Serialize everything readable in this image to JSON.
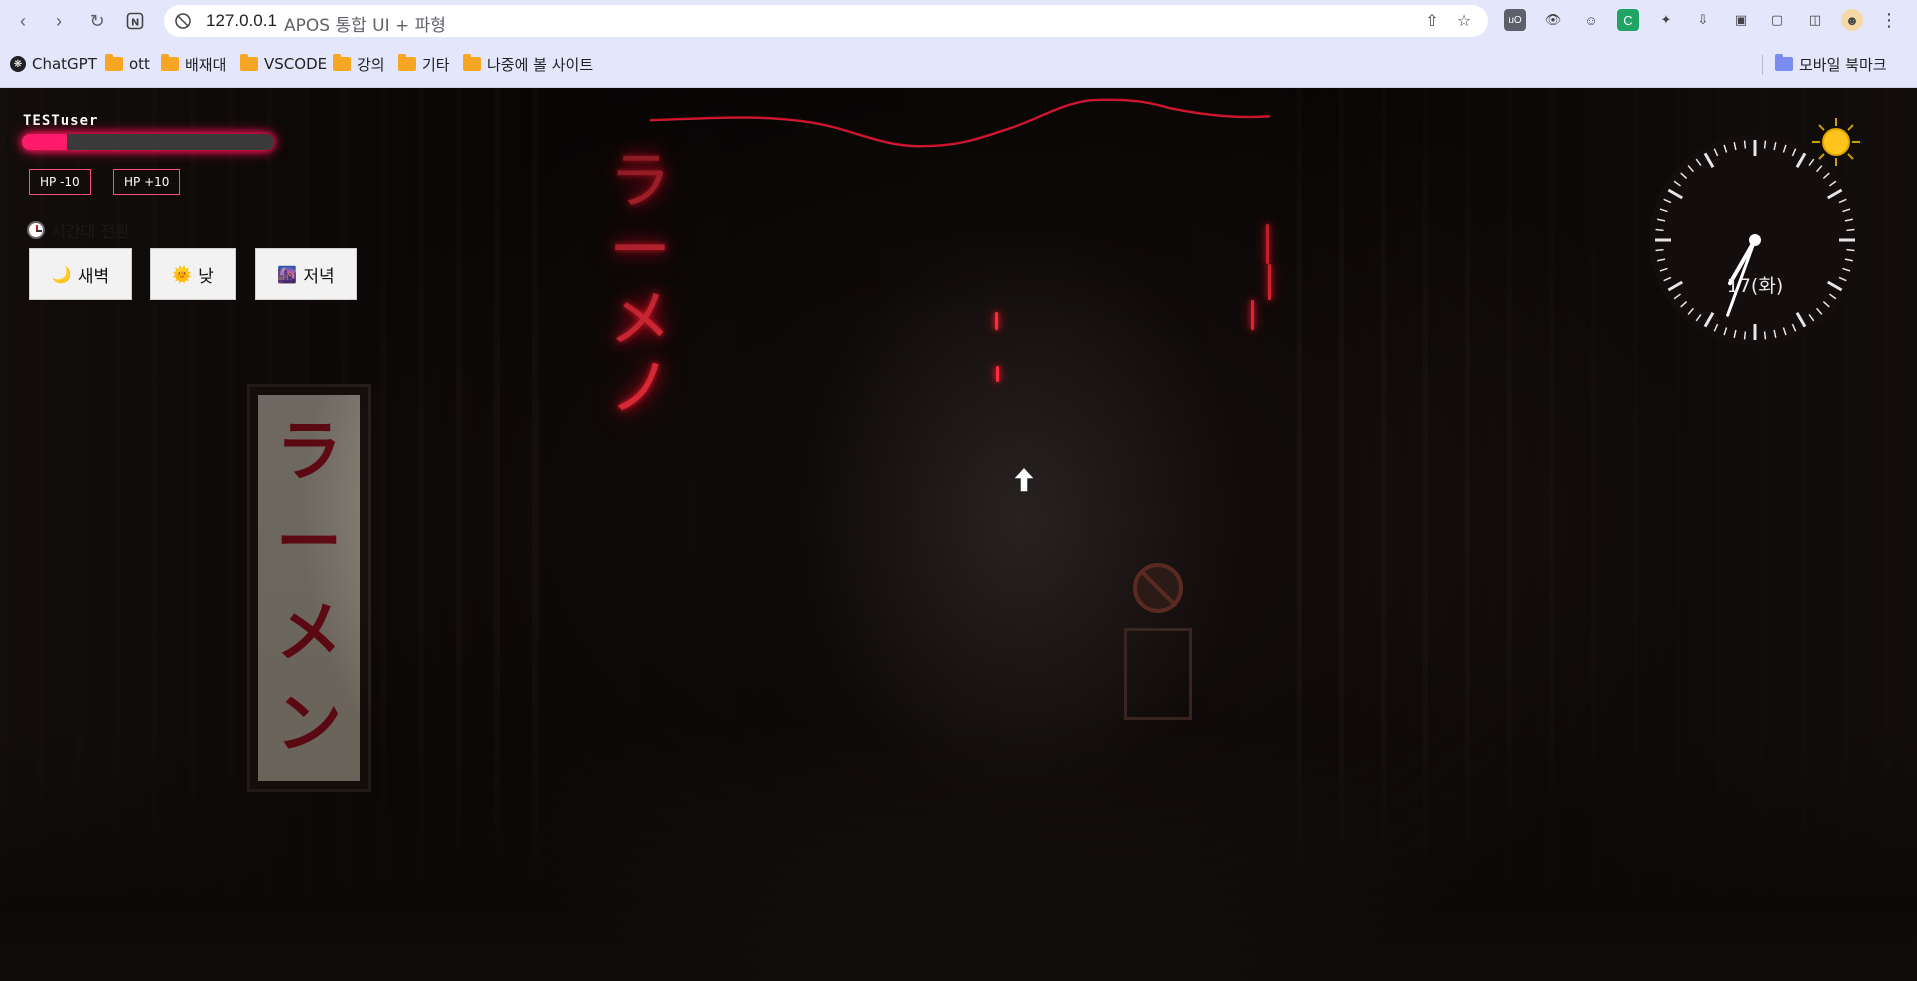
{
  "browser": {
    "url_host": "127.0.0.1",
    "page_title": "APOS 통합 UI + 파형",
    "bookmarks": [
      {
        "label": "ChatGPT",
        "icon": "chatgpt-icon"
      },
      {
        "label": "ott",
        "icon": "folder-icon"
      },
      {
        "label": "배재대",
        "icon": "folder-icon"
      },
      {
        "label": "VSCODE",
        "icon": "folder-icon"
      },
      {
        "label": "강의",
        "icon": "folder-icon"
      },
      {
        "label": "기타",
        "icon": "folder-icon"
      },
      {
        "label": "나중에 볼 사이트",
        "icon": "folder-icon"
      }
    ],
    "mobile_bookmarks": "모바일 북마크"
  },
  "player": {
    "username": "TESTuser",
    "hp_fraction": 0.18,
    "hp_minus_label": "HP -10",
    "hp_plus_label": "HP +10"
  },
  "time_panel": {
    "title": "시간대 전환",
    "buttons": [
      {
        "label": "새벽",
        "icon": "🌙"
      },
      {
        "label": "낮",
        "icon": "🌞"
      },
      {
        "label": "저녁",
        "icon": "🌆"
      }
    ]
  },
  "clock": {
    "date_label": "17(화)",
    "hour_hand_angle_deg": 210,
    "minute_hand_angle_deg": 200
  },
  "scene": {
    "sign_kana": [
      "ラ",
      "ー",
      "メ",
      "ン"
    ],
    "neon_kana": [
      "ラ",
      "ー",
      "メ",
      "ノ"
    ]
  },
  "colors": {
    "hp_accent": "#ff1a6a",
    "neon": "#ff2233",
    "waveform": "#e0102a"
  }
}
